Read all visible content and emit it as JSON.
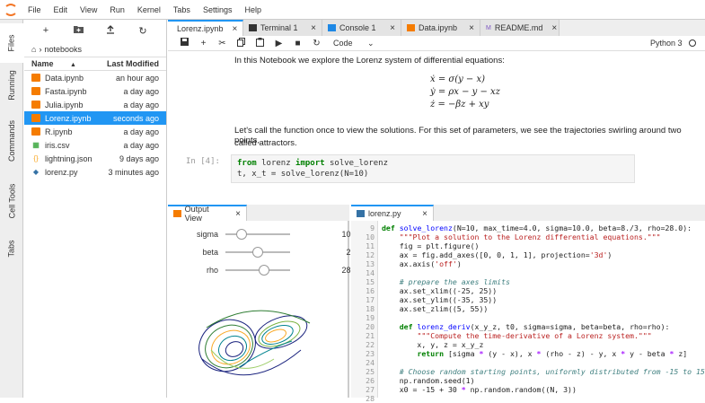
{
  "menubar": {
    "items": [
      "File",
      "Edit",
      "View",
      "Run",
      "Kernel",
      "Tabs",
      "Settings",
      "Help"
    ]
  },
  "left_sidebar": {
    "tabs": [
      "Files",
      "Running",
      "Commands",
      "Cell Tools",
      "Tabs"
    ]
  },
  "file_browser": {
    "breadcrumb": "notebooks",
    "col_name": "Name",
    "col_modified": "Last Modified",
    "files": [
      {
        "name": "Data.ipynb",
        "modified": "an hour ago",
        "icon": "notebook-icon",
        "selected": false
      },
      {
        "name": "Fasta.ipynb",
        "modified": "a day ago",
        "icon": "notebook-icon",
        "selected": false
      },
      {
        "name": "Julia.ipynb",
        "modified": "a day ago",
        "icon": "notebook-icon",
        "selected": false
      },
      {
        "name": "Lorenz.ipynb",
        "modified": "seconds ago",
        "icon": "notebook-icon",
        "selected": true
      },
      {
        "name": "R.ipynb",
        "modified": "a day ago",
        "icon": "notebook-icon",
        "selected": false
      },
      {
        "name": "iris.csv",
        "modified": "a day ago",
        "icon": "csv-icon",
        "selected": false
      },
      {
        "name": "lightning.json",
        "modified": "9 days ago",
        "icon": "json-icon",
        "selected": false
      },
      {
        "name": "lorenz.py",
        "modified": "3 minutes ago",
        "icon": "python-icon",
        "selected": false
      }
    ]
  },
  "doc_tabs": [
    {
      "label": "Lorenz.ipynb",
      "icon": "notebook-icon",
      "active": true
    },
    {
      "label": "Terminal 1",
      "icon": "terminal-icon",
      "active": false
    },
    {
      "label": "Console 1",
      "icon": "console-icon",
      "active": false
    },
    {
      "label": "Data.ipynb",
      "icon": "notebook-icon",
      "active": false
    },
    {
      "label": "README.md",
      "icon": "markdown-icon",
      "active": false
    }
  ],
  "notebook": {
    "cell_type": "Code",
    "kernel": "Python 3",
    "intro": "In this Notebook we explore the Lorenz system of differential equations:",
    "equations": [
      "ẋ = σ(y − x)",
      "ẏ = ρx − y − xz",
      "ż = −βz + xy"
    ],
    "para1": "Let's call the function once to view the solutions. For this set of parameters, we see the trajectories swirling around two points,",
    "para2": "called attractors.",
    "prompt": "In [4]:",
    "code_line2": "t, x_t = solve_lorenz(N=10)"
  },
  "output_view": {
    "tab_label": "Output View",
    "sliders": [
      {
        "name": "sigma",
        "value": "10.00",
        "fraction": 0.25
      },
      {
        "name": "beta",
        "value": "2.67",
        "fraction": 0.5
      },
      {
        "name": "rho",
        "value": "28.00",
        "fraction": 0.6
      }
    ]
  },
  "editor": {
    "tab_label": "lorenz.py",
    "line_numbers": [
      "9",
      "10",
      "11",
      "12",
      "13",
      "14",
      "15",
      "16",
      "17",
      "18",
      "19",
      "20",
      "21",
      "22",
      "23",
      "24",
      "25",
      "26",
      "27",
      "28"
    ]
  }
}
